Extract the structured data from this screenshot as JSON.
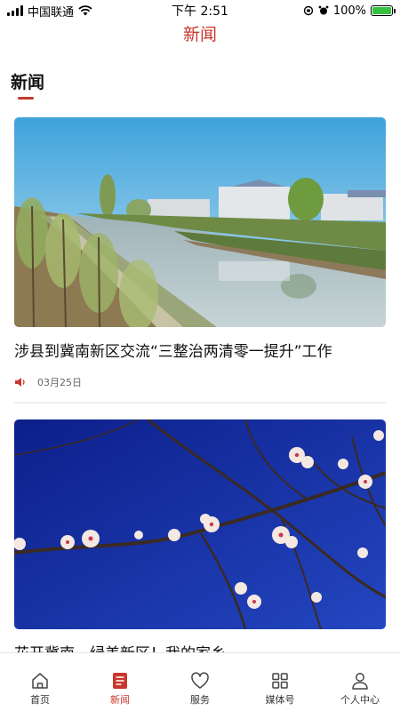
{
  "status_bar": {
    "carrier": "中国联通",
    "time": "下午 2:51",
    "battery_percent": "100%",
    "battery_level": 1.0,
    "battery_color": "#36c13f"
  },
  "nav": {
    "title": "新闻"
  },
  "section": {
    "title": "新闻"
  },
  "articles": [
    {
      "title": "涉县到冀南新区交流“三整治两清零一提升”工作",
      "date": "03月25日",
      "image_icon": "river-village-photo"
    },
    {
      "title": "花开冀南，绿美新区！我的家乡",
      "date": "",
      "image_icon": "blossom-branch-photo"
    }
  ],
  "tab_bar": {
    "items": [
      {
        "label": "首页",
        "icon": "home-icon",
        "active": false
      },
      {
        "label": "新闻",
        "icon": "news-icon",
        "active": true
      },
      {
        "label": "服务",
        "icon": "heart-icon",
        "active": false
      },
      {
        "label": "媒体号",
        "icon": "grid-icon",
        "active": false
      },
      {
        "label": "个人中心",
        "icon": "profile-icon",
        "active": false
      }
    ]
  },
  "colors": {
    "accent": "#c8372d",
    "divider": "#ececec"
  }
}
